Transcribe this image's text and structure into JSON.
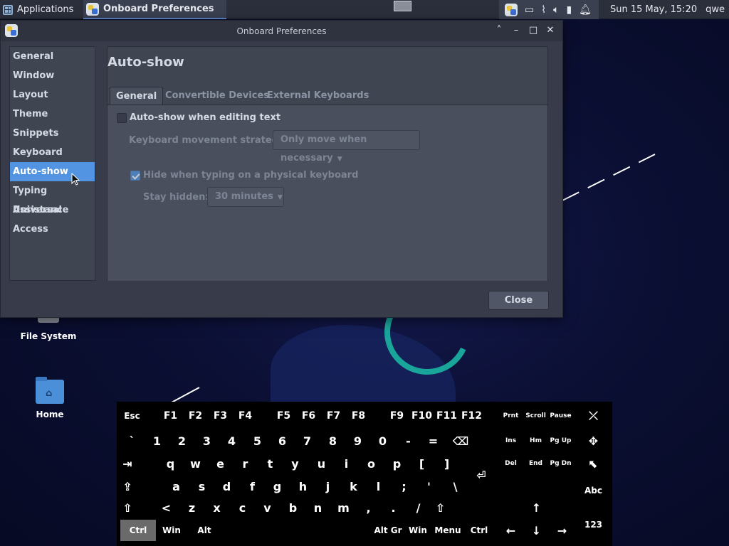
{
  "panel": {
    "apps_label": "Applications",
    "task_label": "Onboard Preferences",
    "clock": "Sun 15 May, 15:20",
    "user": "qwe",
    "tray_icons": [
      "onboard-icon",
      "display-icon",
      "attachment-icon",
      "volume-icon",
      "battery-icon",
      "bell-icon"
    ]
  },
  "window": {
    "title": "Onboard Preferences",
    "controls": [
      "˄",
      "–",
      "□",
      "✕"
    ]
  },
  "sidebar": {
    "items": [
      {
        "label": "General",
        "active": false
      },
      {
        "label": "Window",
        "active": false
      },
      {
        "label": "Layout",
        "active": false
      },
      {
        "label": "Theme",
        "active": false
      },
      {
        "label": "Snippets",
        "active": false
      },
      {
        "label": "Keyboard",
        "active": false
      },
      {
        "label": "Auto-show",
        "active": true
      },
      {
        "label": "Typing Assistance",
        "active": false
      },
      {
        "label": "Universal Access",
        "active": false
      }
    ]
  },
  "main": {
    "heading": "Auto-show",
    "tabs": [
      {
        "label": "General",
        "active": true
      },
      {
        "label": "Convertible Devices",
        "active": false
      },
      {
        "label": "External Keyboards",
        "active": false
      }
    ],
    "auto_show_label": "Auto-show when editing text",
    "auto_show_checked": false,
    "movement_label": "Keyboard movement strategy:",
    "movement_value": "Only move when necessary",
    "hide_label": "Hide when typing on a physical keyboard",
    "hide_checked": true,
    "stay_hidden_label": "Stay hidden:",
    "stay_hidden_value": "30 minutes"
  },
  "footer": {
    "close_label": "Close"
  },
  "desktop": {
    "icons": [
      "File System",
      "Home"
    ]
  },
  "keyboard": {
    "keys": [
      {
        "label": "Esc",
        "cls": "mod"
      },
      {
        "label": "F1",
        "cls": "fkey"
      },
      {
        "label": "F2",
        "cls": "fkey"
      },
      {
        "label": "F3",
        "cls": "fkey"
      },
      {
        "label": "F4",
        "cls": "fkey"
      },
      {
        "label": "F5",
        "cls": "fkey"
      },
      {
        "label": "F6",
        "cls": "fkey"
      },
      {
        "label": "F7",
        "cls": "fkey"
      },
      {
        "label": "F8",
        "cls": "fkey"
      },
      {
        "label": "F9",
        "cls": "fkey"
      },
      {
        "label": "F10",
        "cls": "fkey"
      },
      {
        "label": "F11",
        "cls": "fkey"
      },
      {
        "label": "F12",
        "cls": "fkey"
      },
      {
        "label": "Prnt",
        "cls": "small"
      },
      {
        "label": "Scroll",
        "cls": "small"
      },
      {
        "label": "Pause",
        "cls": "small"
      },
      {
        "label": "⤫",
        "cls": ""
      },
      {
        "label": "`",
        "cls": ""
      },
      {
        "label": "1",
        "cls": ""
      },
      {
        "label": "2",
        "cls": ""
      },
      {
        "label": "3",
        "cls": ""
      },
      {
        "label": "4",
        "cls": ""
      },
      {
        "label": "5",
        "cls": ""
      },
      {
        "label": "6",
        "cls": ""
      },
      {
        "label": "7",
        "cls": ""
      },
      {
        "label": "8",
        "cls": ""
      },
      {
        "label": "9",
        "cls": ""
      },
      {
        "label": "0",
        "cls": ""
      },
      {
        "label": "-",
        "cls": ""
      },
      {
        "label": "=",
        "cls": ""
      },
      {
        "label": "⌫",
        "cls": ""
      },
      {
        "label": "Ins",
        "cls": "small"
      },
      {
        "label": "Hm",
        "cls": "small"
      },
      {
        "label": "Pg Up",
        "cls": "small tworow"
      },
      {
        "label": "✥",
        "cls": ""
      },
      {
        "label": "⇥",
        "cls": ""
      },
      {
        "label": "q",
        "cls": ""
      },
      {
        "label": "w",
        "cls": ""
      },
      {
        "label": "e",
        "cls": ""
      },
      {
        "label": "r",
        "cls": ""
      },
      {
        "label": "t",
        "cls": ""
      },
      {
        "label": "y",
        "cls": ""
      },
      {
        "label": "u",
        "cls": ""
      },
      {
        "label": "i",
        "cls": ""
      },
      {
        "label": "o",
        "cls": ""
      },
      {
        "label": "p",
        "cls": ""
      },
      {
        "label": "[",
        "cls": ""
      },
      {
        "label": "]",
        "cls": ""
      },
      {
        "label": "⏎",
        "cls": ""
      },
      {
        "label": "Del",
        "cls": "small"
      },
      {
        "label": "End",
        "cls": "small"
      },
      {
        "label": "Pg Dn",
        "cls": "small tworow"
      },
      {
        "label": "⬉",
        "cls": ""
      },
      {
        "label": "⇪",
        "cls": ""
      },
      {
        "label": "a",
        "cls": ""
      },
      {
        "label": "s",
        "cls": ""
      },
      {
        "label": "d",
        "cls": ""
      },
      {
        "label": "f",
        "cls": ""
      },
      {
        "label": "g",
        "cls": ""
      },
      {
        "label": "h",
        "cls": ""
      },
      {
        "label": "j",
        "cls": ""
      },
      {
        "label": "k",
        "cls": ""
      },
      {
        "label": "l",
        "cls": ""
      },
      {
        "label": ";",
        "cls": ""
      },
      {
        "label": "'",
        "cls": ""
      },
      {
        "label": "\\",
        "cls": ""
      },
      {
        "label": "Abc",
        "cls": "mod"
      },
      {
        "label": "⇧",
        "cls": ""
      },
      {
        "label": "<",
        "cls": ""
      },
      {
        "label": "z",
        "cls": ""
      },
      {
        "label": "x",
        "cls": ""
      },
      {
        "label": "c",
        "cls": ""
      },
      {
        "label": "v",
        "cls": ""
      },
      {
        "label": "b",
        "cls": ""
      },
      {
        "label": "n",
        "cls": ""
      },
      {
        "label": "m",
        "cls": ""
      },
      {
        "label": ",",
        "cls": ""
      },
      {
        "label": ".",
        "cls": ""
      },
      {
        "label": "/",
        "cls": ""
      },
      {
        "label": "⇧",
        "cls": ""
      },
      {
        "label": "↑",
        "cls": ""
      },
      {
        "label": "Ctrl",
        "cls": "mod pressed"
      },
      {
        "label": "Win",
        "cls": "mod"
      },
      {
        "label": "Alt",
        "cls": "mod"
      },
      {
        "label": "Alt Gr",
        "cls": "mod"
      },
      {
        "label": "Win",
        "cls": "mod"
      },
      {
        "label": "Menu",
        "cls": "mod"
      },
      {
        "label": "Ctrl",
        "cls": "mod"
      },
      {
        "label": "←",
        "cls": ""
      },
      {
        "label": "↓",
        "cls": ""
      },
      {
        "label": "→",
        "cls": ""
      },
      {
        "label": "123",
        "cls": "mod"
      }
    ]
  }
}
